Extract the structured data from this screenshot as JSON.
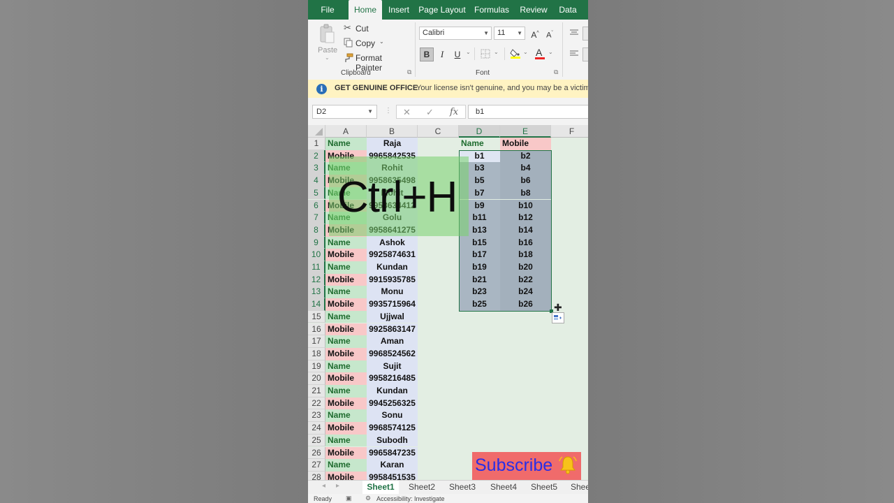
{
  "tabs": [
    "File",
    "Home",
    "Insert",
    "Page Layout",
    "Formulas",
    "Review",
    "Data"
  ],
  "clipboard": {
    "paste": "Paste",
    "cut": "Cut",
    "copy": "Copy",
    "format_painter": "Format Painter",
    "label": "Clipboard"
  },
  "font": {
    "name": "Calibri",
    "size": "11",
    "grow": "A",
    "shrink": "A",
    "bold": "B",
    "italic": "I",
    "underline": "U",
    "color_letter": "A",
    "label": "Font"
  },
  "info": {
    "title": "GET GENUINE OFFICE",
    "message": "Your license isn't genuine, and you may be a victim"
  },
  "formula_bar": {
    "name_box": "D2",
    "fx": "fx",
    "value": "b1"
  },
  "columns": [
    "A",
    "B",
    "C",
    "D",
    "E",
    "F"
  ],
  "rows": [
    "1",
    "2",
    "3",
    "4",
    "5",
    "6",
    "7",
    "8",
    "9",
    "10",
    "11",
    "12",
    "13",
    "14",
    "15",
    "16",
    "17",
    "18",
    "19",
    "20",
    "21",
    "22",
    "23",
    "24",
    "25",
    "26",
    "27",
    "28"
  ],
  "col_a": [
    "Name",
    "Mobile",
    "Name",
    "Mobile",
    "Name",
    "Mobile",
    "Name",
    "Mobile",
    "Name",
    "Mobile",
    "Name",
    "Mobile",
    "Name",
    "Mobile",
    "Name",
    "Mobile",
    "Name",
    "Mobile",
    "Name",
    "Mobile",
    "Name",
    "Mobile",
    "Name",
    "Mobile",
    "Name",
    "Mobile",
    "Name",
    "Mobile"
  ],
  "col_b": [
    "Raja",
    "9965842535",
    "Rohit",
    "9958635498",
    "Mohit",
    "9958634412",
    "Golu",
    "9958641275",
    "Ashok",
    "9925874631",
    "Kundan",
    "9915935785",
    "Monu",
    "9935715964",
    "Ujjwal",
    "9925863147",
    "Aman",
    "9968524562",
    "Sujit",
    "9958216485",
    "Kundan",
    "9945256325",
    "Sonu",
    "9968574125",
    "Subodh",
    "9965847235",
    "Karan",
    "9958451535"
  ],
  "col_d": [
    "Name",
    "b1",
    "b3",
    "b5",
    "b7",
    "b9",
    "b11",
    "b13",
    "b15",
    "b17",
    "b19",
    "b21",
    "b23",
    "b25"
  ],
  "col_e": [
    "Mobile",
    "b2",
    "b4",
    "b6",
    "b8",
    "b10",
    "b12",
    "b14",
    "b16",
    "b18",
    "b20",
    "b22",
    "b24",
    "b26"
  ],
  "overlay_text": "Ctrl+H",
  "sheets": [
    "Sheet1",
    "Sheet2",
    "Sheet3",
    "Sheet4",
    "Sheet5",
    "Shee"
  ],
  "status": {
    "ready": "Ready",
    "accessibility": "Accessibility: Investigate"
  },
  "subscribe": "Subscribe",
  "colors": {
    "excel_green": "#217346",
    "name_fill": "#c6e7cc",
    "mobile_fill": "#f8c8c8",
    "col_b_fill": "#dde3f3",
    "subscribe_bg": "#f06b6b"
  }
}
